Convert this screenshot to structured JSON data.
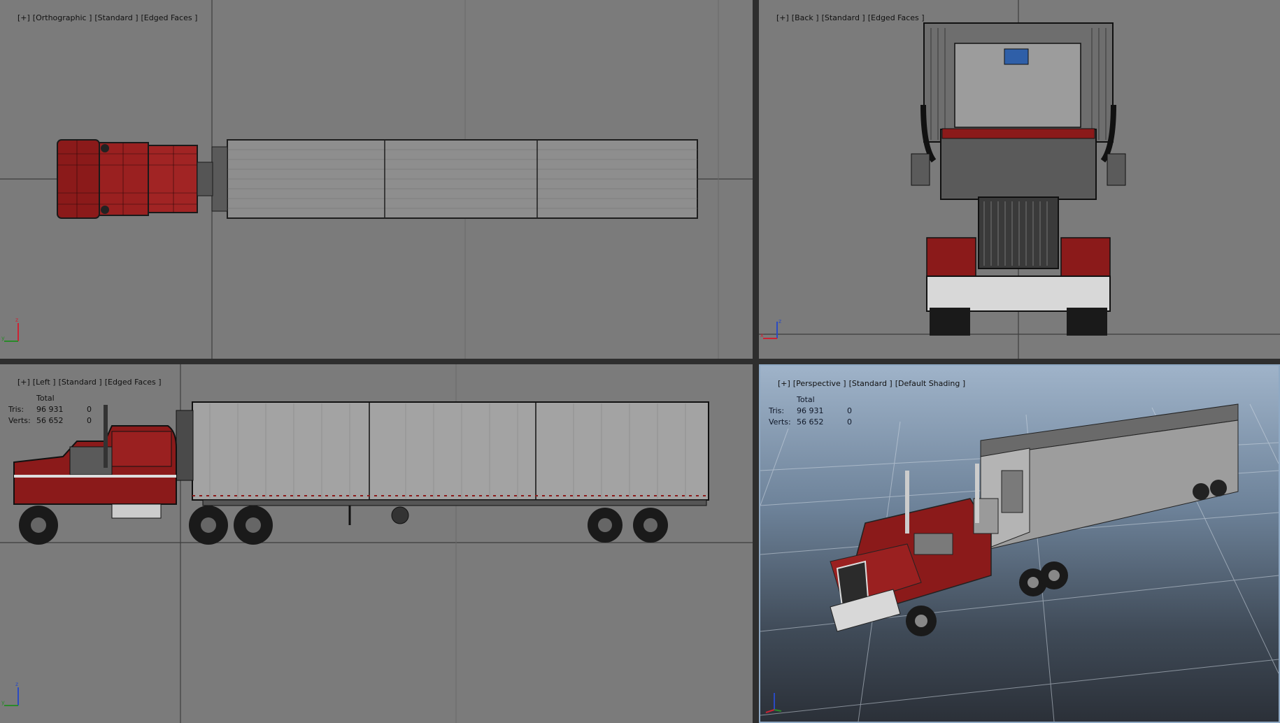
{
  "viewports": {
    "top": {
      "labels": [
        "[+]",
        "[Orthographic ]",
        "[Standard ]",
        "[Edged Faces ]"
      ]
    },
    "back": {
      "labels": [
        "[+]",
        "[Back ]",
        "[Standard ]",
        "[Edged Faces ]"
      ]
    },
    "left": {
      "labels": [
        "[+]",
        "[Left ]",
        "[Standard ]",
        "[Edged Faces ]"
      ]
    },
    "perspective": {
      "labels": [
        "[+]",
        "[Perspective ]",
        "[Standard ]",
        "[Default Shading ]"
      ]
    }
  },
  "stats": {
    "header": "Total",
    "tris_label": "Tris:",
    "tris_value": "96 931",
    "tris_sel": "0",
    "verts_label": "Verts:",
    "verts_value": "56 652",
    "verts_sel": "0"
  },
  "axis": {
    "x": "x",
    "y": "y",
    "z": "z"
  },
  "colors": {
    "viewport_bg": "#7b7b7b",
    "truck_red": "#8b1a1a",
    "trailer_gray": "#9a9a9a",
    "active_border": "#8fa9c4"
  }
}
